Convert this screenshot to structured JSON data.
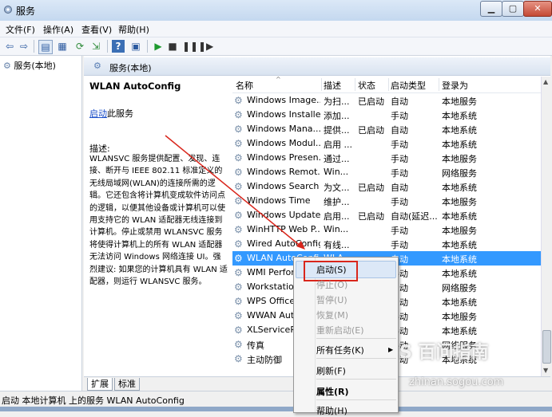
{
  "window": {
    "title": "服务"
  },
  "menu": [
    "文件(F)",
    "操作(A)",
    "查看(V)",
    "帮助(H)"
  ],
  "tree": {
    "root": "服务(本地)"
  },
  "pane": {
    "header": "服务(本地)",
    "service_title": "WLAN AutoConfig",
    "start_link": "启动",
    "start_suffix": "此服务",
    "desc_label": "描述:",
    "desc_text": "WLANSVC 服务提供配置、发现、连接、断开与 IEEE 802.11 标准定义的无线局域网(WLAN)的连接所需的逻辑。它还包含将计算机变成软件访问点的逻辑，以便其他设备或计算机可以使用支持它的 WLAN 适配器无线连接到计算机。停止或禁用 WLANSVC 服务将使得计算机上的所有 WLAN 适配器无法访问 Windows 网络连接 UI。强烈建议: 如果您的计算机具有 WLAN 适配器，则运行 WLANSVC 服务。"
  },
  "table": {
    "columns": [
      "名称",
      "描述",
      "状态",
      "启动类型",
      "登录为"
    ],
    "rows": [
      {
        "name": "Windows Image...",
        "desc": "为扫...",
        "status": "已启动",
        "type": "自动",
        "login": "本地服务"
      },
      {
        "name": "Windows Installer",
        "desc": "添加...",
        "status": "",
        "type": "手动",
        "login": "本地系统"
      },
      {
        "name": "Windows Mana...",
        "desc": "提供...",
        "status": "已启动",
        "type": "自动",
        "login": "本地系统"
      },
      {
        "name": "Windows Modul...",
        "desc": "启用 ...",
        "status": "",
        "type": "手动",
        "login": "本地系统"
      },
      {
        "name": "Windows Presen...",
        "desc": "通过...",
        "status": "",
        "type": "手动",
        "login": "本地服务"
      },
      {
        "name": "Windows Remot...",
        "desc": "Win...",
        "status": "",
        "type": "手动",
        "login": "网络服务"
      },
      {
        "name": "Windows Search",
        "desc": "为文...",
        "status": "已启动",
        "type": "自动",
        "login": "本地系统"
      },
      {
        "name": "Windows Time",
        "desc": "维护...",
        "status": "",
        "type": "手动",
        "login": "本地服务"
      },
      {
        "name": "Windows Update",
        "desc": "启用...",
        "status": "已启动",
        "type": "自动(延迟...",
        "login": "本地系统"
      },
      {
        "name": "WinHTTP Web P...",
        "desc": "Win...",
        "status": "",
        "type": "手动",
        "login": "本地服务"
      },
      {
        "name": "Wired AutoConfig",
        "desc": "有线...",
        "status": "",
        "type": "手动",
        "login": "本地系统"
      },
      {
        "name": "WLAN AutoConfig",
        "desc": "WLA...",
        "status": "",
        "type": "自动",
        "login": "本地系统"
      },
      {
        "name": "WMI Perfor",
        "desc": "",
        "status": "",
        "type": "手动",
        "login": "本地系统"
      },
      {
        "name": "Workstation",
        "desc": "",
        "status": "",
        "type": "自动",
        "login": "网络服务"
      },
      {
        "name": "WPS Office",
        "desc": "",
        "status": "",
        "type": "自动",
        "login": "本地系统"
      },
      {
        "name": "WWAN Auto",
        "desc": "",
        "status": "",
        "type": "手动",
        "login": "本地服务"
      },
      {
        "name": "XLServicePla",
        "desc": "",
        "status": "",
        "type": "手动",
        "login": "本地系统"
      },
      {
        "name": "传真",
        "desc": "",
        "status": "",
        "type": "手动",
        "login": "网络服务"
      },
      {
        "name": "主动防御",
        "desc": "",
        "status": "",
        "type": "自动",
        "login": "本地系统"
      }
    ]
  },
  "context_menu": {
    "start": "启动(S)",
    "stop": "停止(O)",
    "pause": "暂停(U)",
    "resume": "恢复(M)",
    "restart": "重新启动(E)",
    "all_tasks": "所有任务(K)",
    "refresh": "刷新(F)",
    "properties": "属性(R)",
    "help": "帮助(H)"
  },
  "tabs": [
    "扩展",
    "标准"
  ],
  "status_text": "启动 本地计算机 上的服务 WLAN AutoConfig",
  "watermark": {
    "brand": "S 百问指南",
    "url": "zhinan.sogou.com"
  },
  "colors": {
    "selection": "#3399ff",
    "link": "#1b4ec9",
    "annotation": "#d9261c"
  }
}
